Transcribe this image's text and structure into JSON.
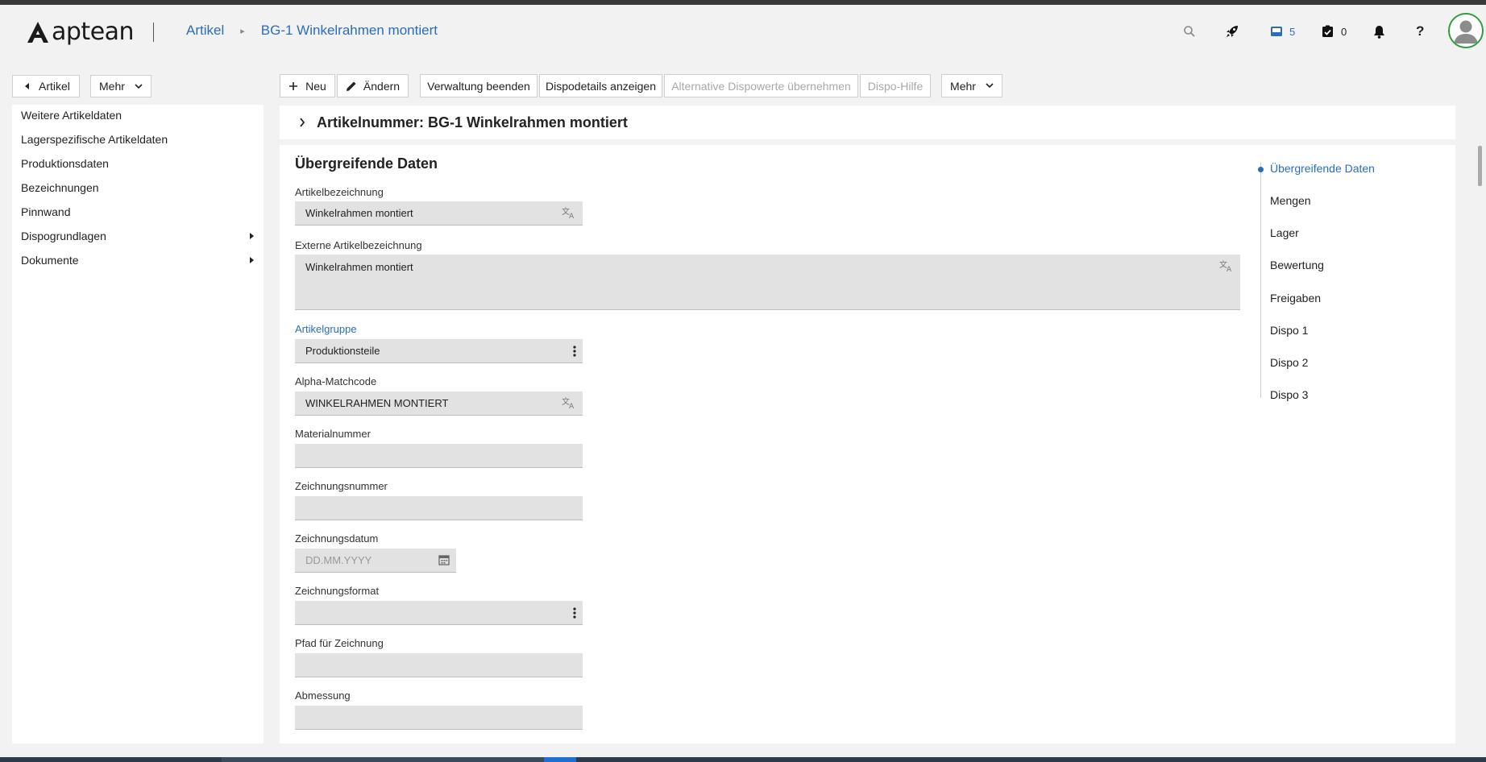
{
  "app": {
    "logo_text": "aptean"
  },
  "breadcrumb": {
    "root": "Artikel",
    "current": "BG-1 Winkelrahmen montiert"
  },
  "header": {
    "inbox_count": "5",
    "tasks_count": "0",
    "help_glyph": "?"
  },
  "left": {
    "back_label": "Artikel",
    "more_label": "Mehr",
    "items": [
      {
        "label": "Weitere Artikeldaten"
      },
      {
        "label": "Lagerspezifische Artikeldaten"
      },
      {
        "label": "Produktionsdaten"
      },
      {
        "label": "Bezeichnungen"
      },
      {
        "label": "Pinnwand"
      },
      {
        "label": "Dispogrundlagen"
      },
      {
        "label": "Dokumente"
      }
    ]
  },
  "toolbar": {
    "new_label": "Neu",
    "edit_label": "Ändern",
    "end_admin_label": "Verwaltung beenden",
    "dispo_details_label": "Dispodetails anzeigen",
    "alt_dispo_label": "Alternative Dispowerte übernehmen",
    "dispo_help_label": "Dispo-Hilfe",
    "more_label": "Mehr"
  },
  "article_bar": {
    "title": "Artikelnummer: BG-1 Winkelrahmen montiert"
  },
  "form": {
    "section_title": "Übergreifende Daten",
    "fields": {
      "artikelbezeichnung": {
        "label": "Artikelbezeichnung",
        "value": "Winkelrahmen montiert"
      },
      "externe": {
        "label": "Externe Artikelbezeichnung",
        "value": "Winkelrahmen montiert"
      },
      "artikelgruppe": {
        "label": "Artikelgruppe",
        "value": "Produktionsteile"
      },
      "alpha": {
        "label": "Alpha-Matchcode",
        "value": "WINKELRAHMEN MONTIERT"
      },
      "material": {
        "label": "Materialnummer",
        "value": ""
      },
      "zeichnungsnummer": {
        "label": "Zeichnungsnummer",
        "value": ""
      },
      "zeichnungsdatum": {
        "label": "Zeichnungsdatum",
        "placeholder": "DD.MM.YYYY"
      },
      "zeichnungsformat": {
        "label": "Zeichnungsformat",
        "value": ""
      },
      "pfad": {
        "label": "Pfad für Zeichnung",
        "value": ""
      },
      "abmessung": {
        "label": "Abmessung",
        "value": ""
      }
    }
  },
  "anchors": [
    {
      "label": "Übergreifende Daten",
      "active": true
    },
    {
      "label": "Mengen"
    },
    {
      "label": "Lager"
    },
    {
      "label": "Bewertung"
    },
    {
      "label": "Freigaben"
    },
    {
      "label": "Dispo 1"
    },
    {
      "label": "Dispo 2"
    },
    {
      "label": "Dispo 3"
    }
  ],
  "colors": {
    "accent": "#2a6ebb",
    "avatar_ring": "#2e9b3e",
    "field_bg": "#e2e2e2"
  }
}
